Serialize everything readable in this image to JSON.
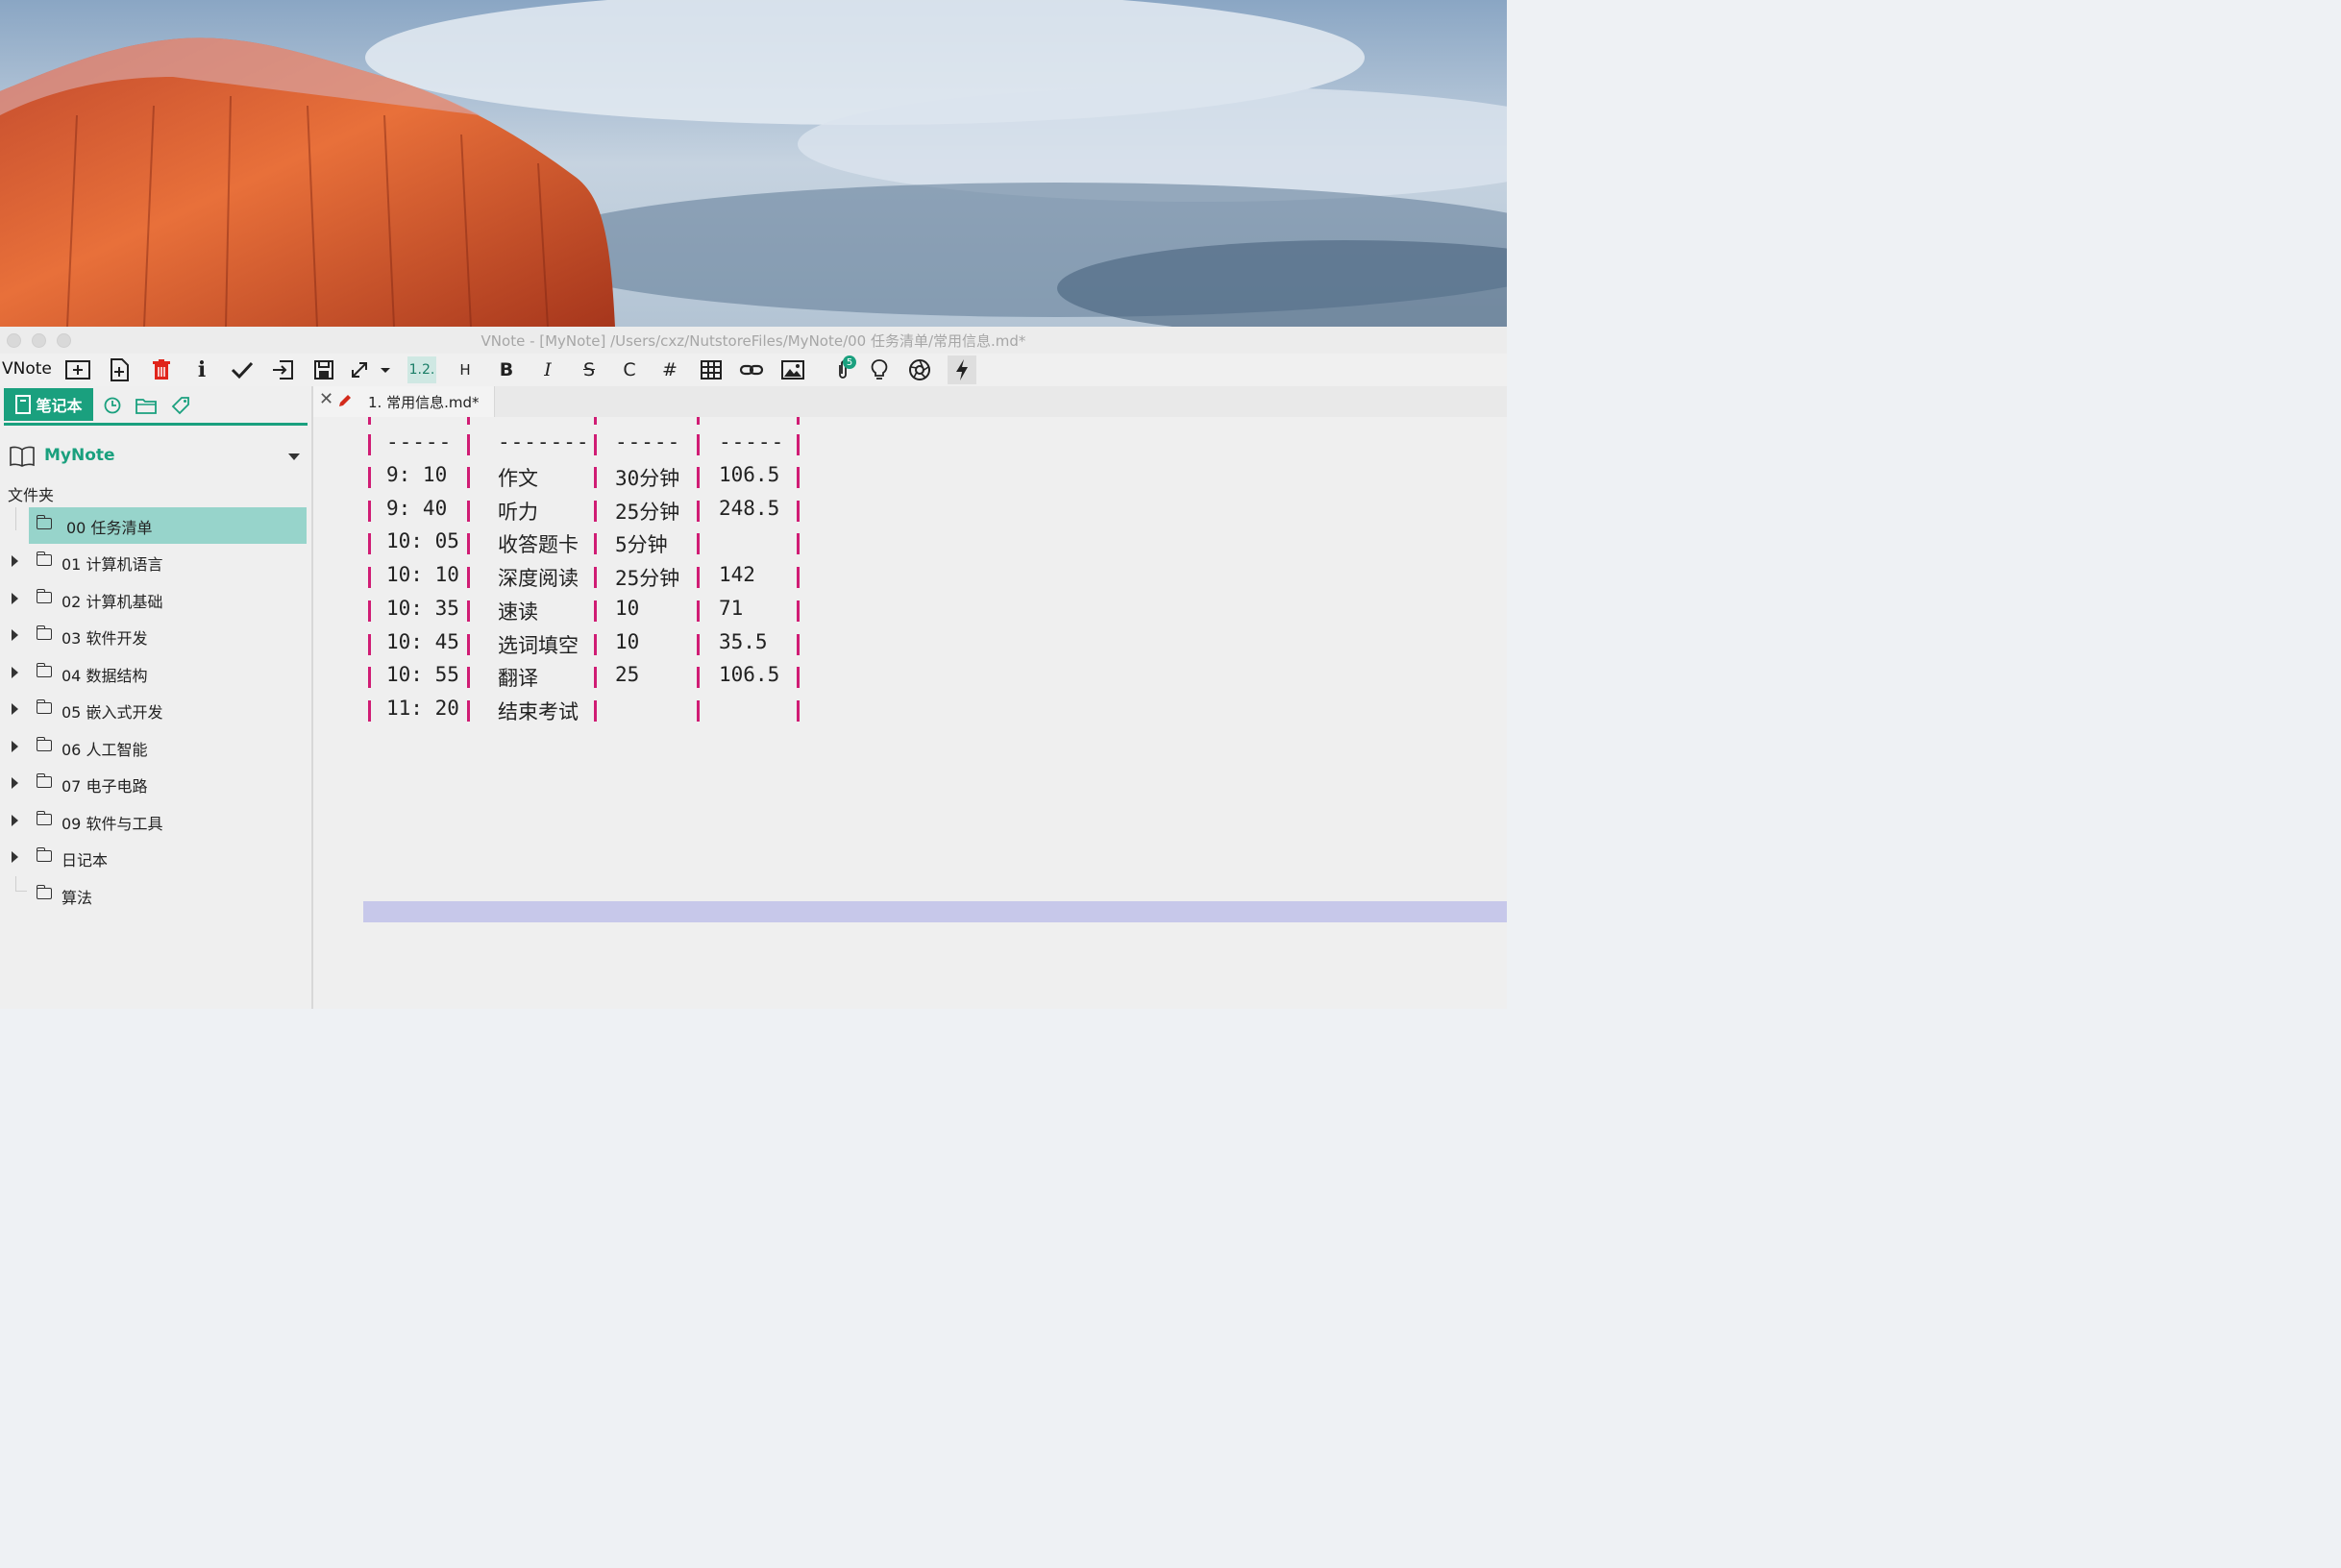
{
  "window": {
    "title": "VNote - [MyNote] /Users/cxz/NutstoreFiles/MyNote/00 任务清单/常用信息.md*"
  },
  "toolbar": {
    "app_name": "VNote",
    "heading_seq_label": "1.2.",
    "heading_label": "H",
    "bold_label": "B",
    "italic_label": "I",
    "strike_label": "S",
    "code_label": "C",
    "hash_label": "#",
    "attachments_count": "5"
  },
  "sidebar": {
    "notebook_tab_label": "笔记本",
    "notebook_name": "MyNote",
    "folders_label": "文件夹",
    "folders": [
      {
        "label": "00 任务清单",
        "selected": true,
        "expandable": false
      },
      {
        "label": "01 计算机语言",
        "selected": false,
        "expandable": true
      },
      {
        "label": "02 计算机基础",
        "selected": false,
        "expandable": true
      },
      {
        "label": "03 软件开发",
        "selected": false,
        "expandable": true
      },
      {
        "label": "04 数据结构",
        "selected": false,
        "expandable": true
      },
      {
        "label": "05 嵌入式开发",
        "selected": false,
        "expandable": true
      },
      {
        "label": "06 人工智能",
        "selected": false,
        "expandable": true
      },
      {
        "label": "07 电子电路",
        "selected": false,
        "expandable": true
      },
      {
        "label": "09 软件与工具",
        "selected": false,
        "expandable": true
      },
      {
        "label": "日记本",
        "selected": false,
        "expandable": true
      },
      {
        "label": "算法",
        "selected": false,
        "expandable": false
      }
    ]
  },
  "editor": {
    "tab_label": "1. 常用信息.md*",
    "separator": [
      "-----",
      "-------",
      "-----",
      "-----"
    ],
    "rows": [
      [
        "9: 10",
        "作文",
        "30分钟",
        "106.5"
      ],
      [
        "9: 40",
        "听力",
        "25分钟",
        "248.5"
      ],
      [
        "10: 05",
        "收答题卡",
        "5分钟",
        ""
      ],
      [
        "10: 10",
        "深度阅读",
        "25分钟",
        "142"
      ],
      [
        "10: 35",
        "速读",
        "10",
        "71"
      ],
      [
        "10: 45",
        "选词填空",
        "10",
        "35.5"
      ],
      [
        "10: 55",
        "翻译",
        "25",
        "106.5"
      ],
      [
        "11: 20",
        "结束考试",
        "",
        ""
      ]
    ]
  },
  "colors": {
    "accent": "#1aa07e",
    "selected_folder_bg": "#97d4cb",
    "table_pipe": "#d01c74",
    "line_highlight": "#c7c8ea"
  }
}
